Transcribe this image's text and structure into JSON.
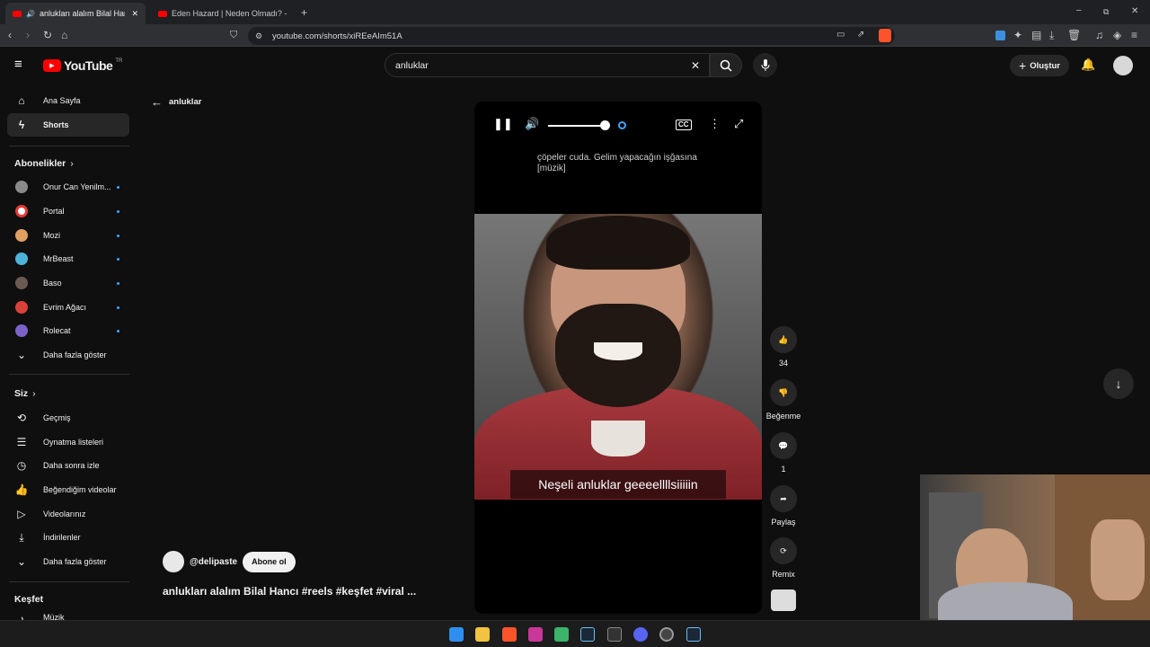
{
  "browser": {
    "tabs": [
      {
        "label": "anlukları alalım Bilal Hancı #r..."
      },
      {
        "label": "Eden Hazard | Neden Olmadı? - YouT..."
      }
    ],
    "url": "youtube.com/shorts/xiREeAIm51A"
  },
  "youtube": {
    "logo_text": "YouTube",
    "region": "TR",
    "search_value": "anluklar",
    "create_label": "Oluştur"
  },
  "sidebar": {
    "main": [
      {
        "label": "Ana Sayfa",
        "icon": "home-icon"
      },
      {
        "label": "Shorts",
        "icon": "shorts-icon"
      }
    ],
    "subscriptions_header": "Abonelikler",
    "subscriptions": [
      {
        "label": "Onur Can Yenilm...",
        "color": "#8a8a8a"
      },
      {
        "label": "Portal",
        "color": "#e53935"
      },
      {
        "label": "Mozi",
        "color": "#e0a060"
      },
      {
        "label": "MrBeast",
        "color": "#4fb3d9"
      },
      {
        "label": "Baso",
        "color": "#6a5a50"
      },
      {
        "label": "Evrim Ağacı",
        "color": "#d9403a"
      },
      {
        "label": "Rolecat",
        "color": "#7a62c9"
      }
    ],
    "show_more_1": "Daha fazla göster",
    "you_header": "Siz",
    "you": [
      {
        "label": "Geçmiş",
        "icon": "history-icon"
      },
      {
        "label": "Oynatma listeleri",
        "icon": "playlist-icon"
      },
      {
        "label": "Daha sonra izle",
        "icon": "clock-icon"
      },
      {
        "label": "Beğendiğim videolar",
        "icon": "like-icon"
      },
      {
        "label": "Videolarınız",
        "icon": "video-icon"
      },
      {
        "label": "İndirilenler",
        "icon": "download-icon"
      }
    ],
    "show_more_2": "Daha fazla göster",
    "explore_header": "Keşfet",
    "explore_partial": "Müzik"
  },
  "shorts": {
    "back_label": "anluklar",
    "caption_line1": "çöpeler cuda. Gelim yapacağın işğasına",
    "caption_line2": "[müzik]",
    "video_overlay_text": "Neşeli anluklar geeeellllsiiiiin",
    "channel": "@delipaste",
    "subscribe_label": "Abone ol",
    "title": "anlukları alalım Bilal Hancı #reels #keşfet #viral ...",
    "actions": {
      "like_count": "34",
      "dislike_label": "Beğenme",
      "comment_count": "1",
      "share_label": "Paylaş",
      "remix_label": "Remix"
    },
    "volume_level": 0.9
  }
}
